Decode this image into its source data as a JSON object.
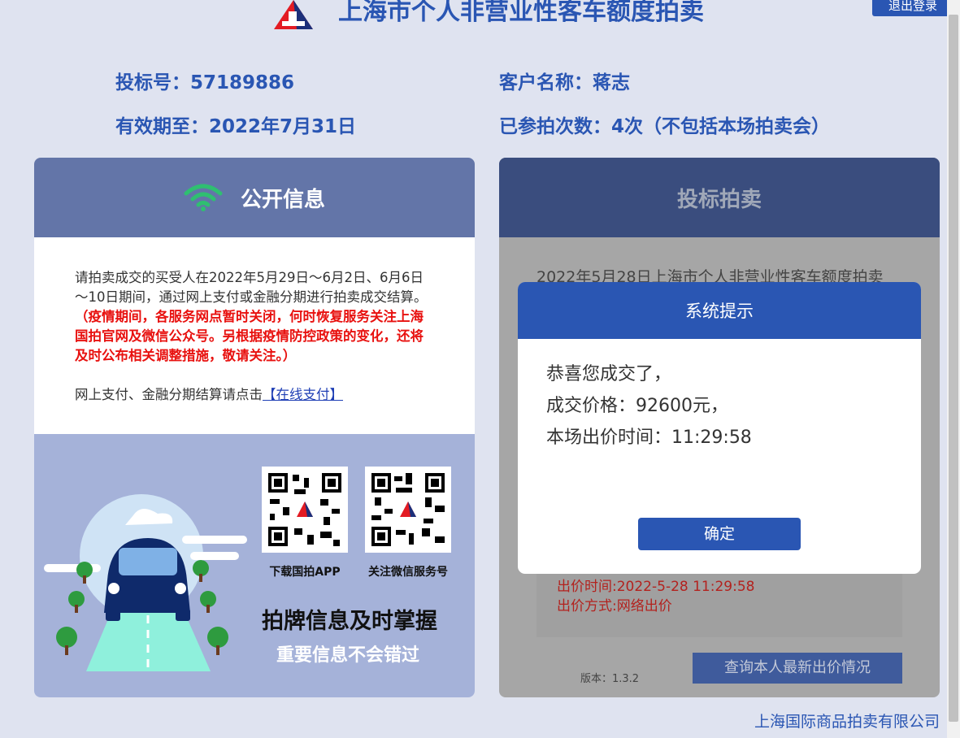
{
  "header": {
    "title": "上海市个人非营业性客车额度拍卖",
    "logout_label": "退出登录"
  },
  "account": {
    "bid_number": "投标号：57189886",
    "customer_name": "客户名称：蒋志",
    "valid_until": "有效期至：2022年7月31日",
    "participation_count": "已参拍次数：4次（不包括本场拍卖会）"
  },
  "public_info": {
    "title": "公开信息",
    "notice_text": "请拍卖成交的买受人在2022年5月29日～6月2日、6月6日～10日期间，通过网上支付或金融分期进行拍卖成交结算。",
    "notice_red": "（疫情期间，各服务网点暂时关闭，何时恢复服务关注上海国拍官网及微信公众号。另根据疫情防控政策的变化，还将及时公布相关调整措施，敬请关注。）",
    "pay_text": "网上支付、金融分期结算请点击",
    "pay_link": "【在线支付】",
    "qr_app_label": "下载国拍APP",
    "qr_wechat_label": "关注微信服务号",
    "promo_title": "拍牌信息及时掌握",
    "promo_sub": "重要信息不会错过"
  },
  "auction": {
    "title": "投标拍卖",
    "session_title": "2022年5月28日上海市个人非营业性客车额度拍卖",
    "bid_time": "出价时间:2022-5-28 11:29:58",
    "bid_method": "出价方式:网络出价",
    "version": "版本：1.3.2",
    "query_button": "查询本人最新出价情况"
  },
  "modal": {
    "title": "系统提示",
    "line1": "恭喜您成交了，",
    "line2": "成交价格：92600元，",
    "line3": "本场出价时间：11:29:58",
    "confirm_label": "确定"
  },
  "footer": {
    "company": "上海国际商品拍卖有限公司"
  },
  "colors": {
    "brand_blue": "#2a56b3",
    "alert_red": "#e8110f",
    "wifi_green": "#2fbf71"
  },
  "icons": [
    "logo-icon",
    "wifi-icon",
    "qr-code-icon",
    "car-illustration"
  ]
}
